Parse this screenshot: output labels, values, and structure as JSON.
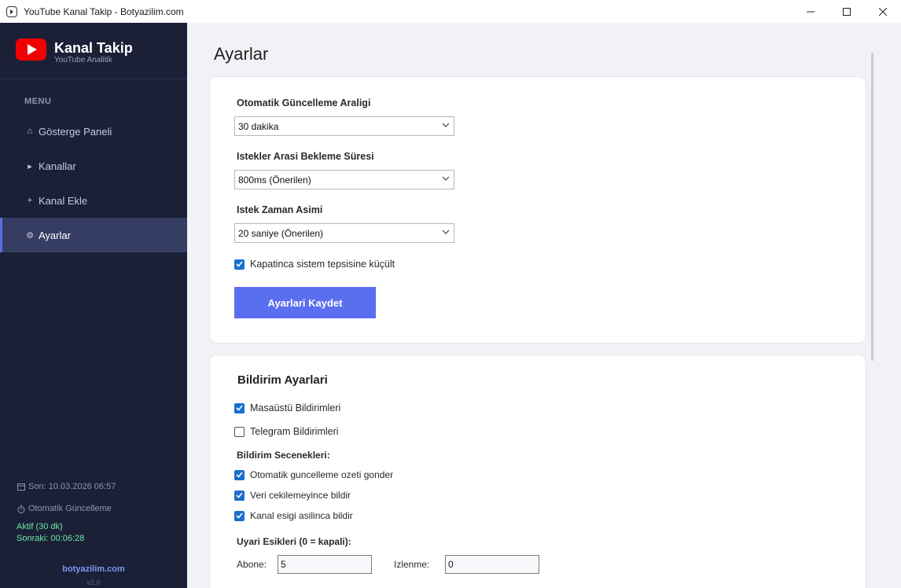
{
  "window": {
    "title": "YouTube Kanal Takip - Botyazilim.com"
  },
  "sidebar": {
    "brand_title": "Kanal Takip",
    "brand_subtitle": "YouTube Analitik",
    "menu_label": "MENU",
    "items": [
      {
        "icon": "home-icon",
        "glyph": "⌂",
        "label": "Gösterge Paneli"
      },
      {
        "icon": "play-icon",
        "glyph": "▸",
        "label": "Kanallar"
      },
      {
        "icon": "plus-icon",
        "glyph": "+",
        "label": "Kanal Ekle"
      },
      {
        "icon": "gear-icon",
        "glyph": "⚙",
        "label": "Ayarlar",
        "active": true
      }
    ],
    "last_update": "Son: 10.03.2026 06:57",
    "auto_update_label": "Otomatik Güncelleme",
    "status_active": "Aktif (30 dk)",
    "status_next": "Sonraki: 00:06:28",
    "website": "botyazilim.com",
    "version": "v2.0",
    "accent": "#5a6fe0",
    "status_color": "#6ee7a0"
  },
  "main": {
    "page_title": "Ayarlar",
    "settings": {
      "interval_label": "Otomatik Güncelleme Araligi",
      "interval_value": "30 dakika",
      "delay_label": "Istekler Arasi Bekleme Süresi",
      "delay_value": "800ms (Önerilen)",
      "timeout_label": "Istek Zaman Asimi",
      "timeout_value": "20 saniye (Önerilen)",
      "tray_label": "Kapatinca sistem tepsisine küçült",
      "tray_checked": true,
      "save_label": "Ayarlari Kaydet",
      "save_color": "#5a6ff0"
    },
    "notifications": {
      "title": "Bildirim Ayarlari",
      "desktop_label": "Masaüstü Bildirimleri",
      "desktop_checked": true,
      "telegram_label": "Telegram Bildirimleri",
      "telegram_checked": false,
      "options_label": "Bildirim Secenekleri:",
      "opt_summary": "Otomatik guncelleme ozeti gonder",
      "opt_fetch_fail": "Veri cekilemeyince bildir",
      "opt_threshold": "Kanal esigi asilinca bildir",
      "thresholds_label": "Uyari Esikleri (0 = kapali):",
      "subs_label": "Abone:",
      "subs_value": "5",
      "views_label": "Izlenme:",
      "views_value": "0"
    }
  }
}
